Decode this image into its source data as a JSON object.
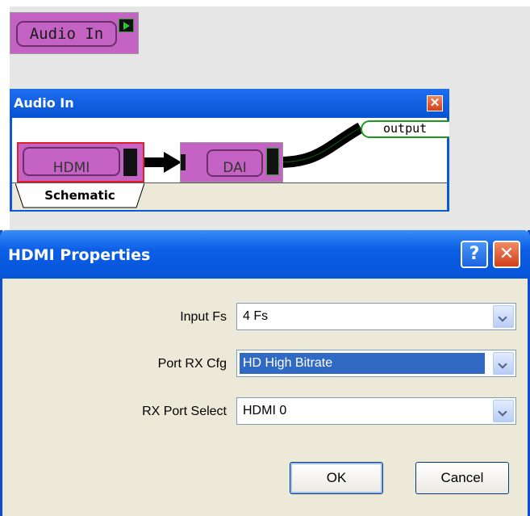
{
  "top_block": {
    "label": "Audio In"
  },
  "audio_window": {
    "title": "Audio In",
    "close_glyph": "✕",
    "blocks": {
      "hdmi": "HDMI",
      "dai": "DAI",
      "output": "output"
    },
    "tab": "Schematic"
  },
  "dialog": {
    "title": "HDMI Properties",
    "help_glyph": "?",
    "close_glyph": "✕",
    "fields": [
      {
        "label": "Input Fs",
        "value": "4 Fs"
      },
      {
        "label": "Port RX Cfg",
        "value": "HD High Bitrate"
      },
      {
        "label": "RX Port Select",
        "value": "HDMI 0"
      }
    ],
    "ok": "OK",
    "cancel": "Cancel"
  },
  "colors": {
    "block_fill": "#c463c4",
    "title_blue": "#0654d8",
    "selection": "#316ac5",
    "wire": "#000000",
    "port_green": "#2ec52e"
  }
}
